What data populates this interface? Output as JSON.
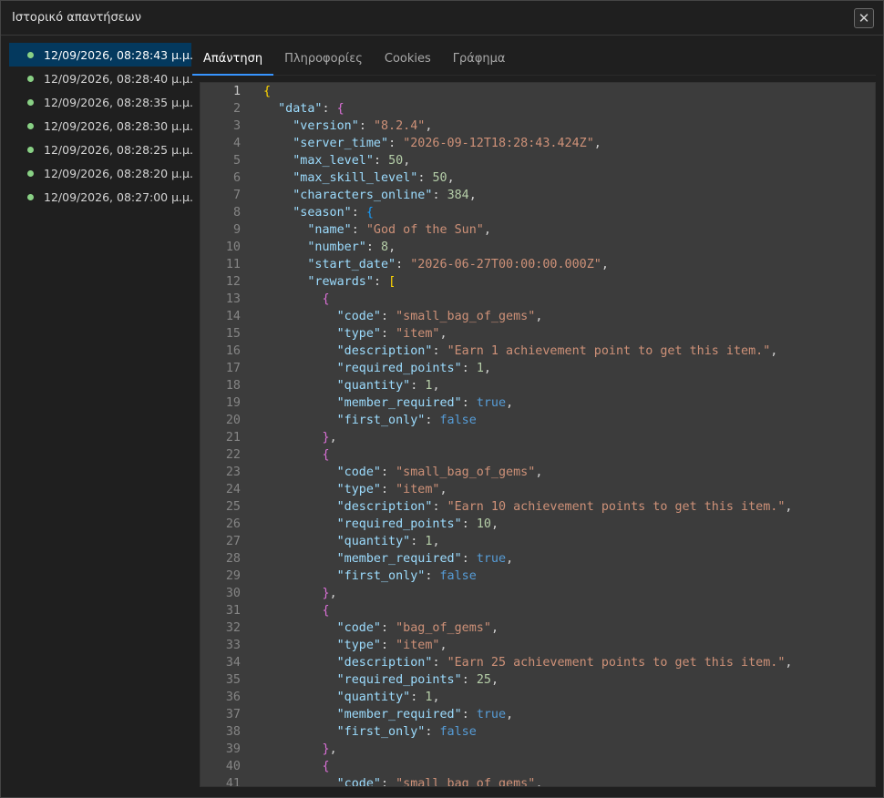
{
  "window": {
    "title": "Ιστορικό απαντήσεων",
    "close_glyph": "✕"
  },
  "history": [
    {
      "label": "12/09/2026, 08:28:43 μ.μ.",
      "active": true
    },
    {
      "label": "12/09/2026, 08:28:40 μ.μ.",
      "active": false
    },
    {
      "label": "12/09/2026, 08:28:35 μ.μ.",
      "active": false
    },
    {
      "label": "12/09/2026, 08:28:30 μ.μ.",
      "active": false
    },
    {
      "label": "12/09/2026, 08:28:25 μ.μ.",
      "active": false
    },
    {
      "label": "12/09/2026, 08:28:20 μ.μ.",
      "active": false
    },
    {
      "label": "12/09/2026, 08:27:00 μ.μ.",
      "active": false
    }
  ],
  "tabs": [
    {
      "label": "Απάντηση",
      "active": true
    },
    {
      "label": "Πληροφορίες",
      "active": false
    },
    {
      "label": "Cookies",
      "active": false
    },
    {
      "label": "Γράφημα",
      "active": false
    }
  ],
  "status_color": "#89d185",
  "accent_color": "#3794ff",
  "code_lines": [
    [
      [
        "br1",
        "{"
      ]
    ],
    [
      [
        "p",
        "  "
      ],
      [
        "k",
        "\"data\""
      ],
      [
        "p",
        ": "
      ],
      [
        "br2",
        "{"
      ]
    ],
    [
      [
        "p",
        "    "
      ],
      [
        "k",
        "\"version\""
      ],
      [
        "p",
        ": "
      ],
      [
        "s",
        "\"8.2.4\""
      ],
      [
        "p",
        ","
      ]
    ],
    [
      [
        "p",
        "    "
      ],
      [
        "k",
        "\"server_time\""
      ],
      [
        "p",
        ": "
      ],
      [
        "s",
        "\"2026-09-12T18:28:43.424Z\""
      ],
      [
        "p",
        ","
      ]
    ],
    [
      [
        "p",
        "    "
      ],
      [
        "k",
        "\"max_level\""
      ],
      [
        "p",
        ": "
      ],
      [
        "n",
        "50"
      ],
      [
        "p",
        ","
      ]
    ],
    [
      [
        "p",
        "    "
      ],
      [
        "k",
        "\"max_skill_level\""
      ],
      [
        "p",
        ": "
      ],
      [
        "n",
        "50"
      ],
      [
        "p",
        ","
      ]
    ],
    [
      [
        "p",
        "    "
      ],
      [
        "k",
        "\"characters_online\""
      ],
      [
        "p",
        ": "
      ],
      [
        "n",
        "384"
      ],
      [
        "p",
        ","
      ]
    ],
    [
      [
        "p",
        "    "
      ],
      [
        "k",
        "\"season\""
      ],
      [
        "p",
        ": "
      ],
      [
        "br3",
        "{"
      ]
    ],
    [
      [
        "p",
        "      "
      ],
      [
        "k",
        "\"name\""
      ],
      [
        "p",
        ": "
      ],
      [
        "s",
        "\"God of the Sun\""
      ],
      [
        "p",
        ","
      ]
    ],
    [
      [
        "p",
        "      "
      ],
      [
        "k",
        "\"number\""
      ],
      [
        "p",
        ": "
      ],
      [
        "n",
        "8"
      ],
      [
        "p",
        ","
      ]
    ],
    [
      [
        "p",
        "      "
      ],
      [
        "k",
        "\"start_date\""
      ],
      [
        "p",
        ": "
      ],
      [
        "s",
        "\"2026-06-27T00:00:00.000Z\""
      ],
      [
        "p",
        ","
      ]
    ],
    [
      [
        "p",
        "      "
      ],
      [
        "k",
        "\"rewards\""
      ],
      [
        "p",
        ": "
      ],
      [
        "br1",
        "["
      ]
    ],
    [
      [
        "p",
        "        "
      ],
      [
        "br2",
        "{"
      ]
    ],
    [
      [
        "p",
        "          "
      ],
      [
        "k",
        "\"code\""
      ],
      [
        "p",
        ": "
      ],
      [
        "s",
        "\"small_bag_of_gems\""
      ],
      [
        "p",
        ","
      ]
    ],
    [
      [
        "p",
        "          "
      ],
      [
        "k",
        "\"type\""
      ],
      [
        "p",
        ": "
      ],
      [
        "s",
        "\"item\""
      ],
      [
        "p",
        ","
      ]
    ],
    [
      [
        "p",
        "          "
      ],
      [
        "k",
        "\"description\""
      ],
      [
        "p",
        ": "
      ],
      [
        "s",
        "\"Earn 1 achievement point to get this item.\""
      ],
      [
        "p",
        ","
      ]
    ],
    [
      [
        "p",
        "          "
      ],
      [
        "k",
        "\"required_points\""
      ],
      [
        "p",
        ": "
      ],
      [
        "n",
        "1"
      ],
      [
        "p",
        ","
      ]
    ],
    [
      [
        "p",
        "          "
      ],
      [
        "k",
        "\"quantity\""
      ],
      [
        "p",
        ": "
      ],
      [
        "n",
        "1"
      ],
      [
        "p",
        ","
      ]
    ],
    [
      [
        "p",
        "          "
      ],
      [
        "k",
        "\"member_required\""
      ],
      [
        "p",
        ": "
      ],
      [
        "b",
        "true"
      ],
      [
        "p",
        ","
      ]
    ],
    [
      [
        "p",
        "          "
      ],
      [
        "k",
        "\"first_only\""
      ],
      [
        "p",
        ": "
      ],
      [
        "b",
        "false"
      ]
    ],
    [
      [
        "p",
        "        "
      ],
      [
        "br2",
        "}"
      ],
      [
        "p",
        ","
      ]
    ],
    [
      [
        "p",
        "        "
      ],
      [
        "br2",
        "{"
      ]
    ],
    [
      [
        "p",
        "          "
      ],
      [
        "k",
        "\"code\""
      ],
      [
        "p",
        ": "
      ],
      [
        "s",
        "\"small_bag_of_gems\""
      ],
      [
        "p",
        ","
      ]
    ],
    [
      [
        "p",
        "          "
      ],
      [
        "k",
        "\"type\""
      ],
      [
        "p",
        ": "
      ],
      [
        "s",
        "\"item\""
      ],
      [
        "p",
        ","
      ]
    ],
    [
      [
        "p",
        "          "
      ],
      [
        "k",
        "\"description\""
      ],
      [
        "p",
        ": "
      ],
      [
        "s",
        "\"Earn 10 achievement points to get this item.\""
      ],
      [
        "p",
        ","
      ]
    ],
    [
      [
        "p",
        "          "
      ],
      [
        "k",
        "\"required_points\""
      ],
      [
        "p",
        ": "
      ],
      [
        "n",
        "10"
      ],
      [
        "p",
        ","
      ]
    ],
    [
      [
        "p",
        "          "
      ],
      [
        "k",
        "\"quantity\""
      ],
      [
        "p",
        ": "
      ],
      [
        "n",
        "1"
      ],
      [
        "p",
        ","
      ]
    ],
    [
      [
        "p",
        "          "
      ],
      [
        "k",
        "\"member_required\""
      ],
      [
        "p",
        ": "
      ],
      [
        "b",
        "true"
      ],
      [
        "p",
        ","
      ]
    ],
    [
      [
        "p",
        "          "
      ],
      [
        "k",
        "\"first_only\""
      ],
      [
        "p",
        ": "
      ],
      [
        "b",
        "false"
      ]
    ],
    [
      [
        "p",
        "        "
      ],
      [
        "br2",
        "}"
      ],
      [
        "p",
        ","
      ]
    ],
    [
      [
        "p",
        "        "
      ],
      [
        "br2",
        "{"
      ]
    ],
    [
      [
        "p",
        "          "
      ],
      [
        "k",
        "\"code\""
      ],
      [
        "p",
        ": "
      ],
      [
        "s",
        "\"bag_of_gems\""
      ],
      [
        "p",
        ","
      ]
    ],
    [
      [
        "p",
        "          "
      ],
      [
        "k",
        "\"type\""
      ],
      [
        "p",
        ": "
      ],
      [
        "s",
        "\"item\""
      ],
      [
        "p",
        ","
      ]
    ],
    [
      [
        "p",
        "          "
      ],
      [
        "k",
        "\"description\""
      ],
      [
        "p",
        ": "
      ],
      [
        "s",
        "\"Earn 25 achievement points to get this item.\""
      ],
      [
        "p",
        ","
      ]
    ],
    [
      [
        "p",
        "          "
      ],
      [
        "k",
        "\"required_points\""
      ],
      [
        "p",
        ": "
      ],
      [
        "n",
        "25"
      ],
      [
        "p",
        ","
      ]
    ],
    [
      [
        "p",
        "          "
      ],
      [
        "k",
        "\"quantity\""
      ],
      [
        "p",
        ": "
      ],
      [
        "n",
        "1"
      ],
      [
        "p",
        ","
      ]
    ],
    [
      [
        "p",
        "          "
      ],
      [
        "k",
        "\"member_required\""
      ],
      [
        "p",
        ": "
      ],
      [
        "b",
        "true"
      ],
      [
        "p",
        ","
      ]
    ],
    [
      [
        "p",
        "          "
      ],
      [
        "k",
        "\"first_only\""
      ],
      [
        "p",
        ": "
      ],
      [
        "b",
        "false"
      ]
    ],
    [
      [
        "p",
        "        "
      ],
      [
        "br2",
        "}"
      ],
      [
        "p",
        ","
      ]
    ],
    [
      [
        "p",
        "        "
      ],
      [
        "br2",
        "{"
      ]
    ],
    [
      [
        "p",
        "          "
      ],
      [
        "k",
        "\"code\""
      ],
      [
        "p",
        ": "
      ],
      [
        "s",
        "\"small_bag_of_gems\""
      ],
      [
        "p",
        ","
      ]
    ]
  ]
}
